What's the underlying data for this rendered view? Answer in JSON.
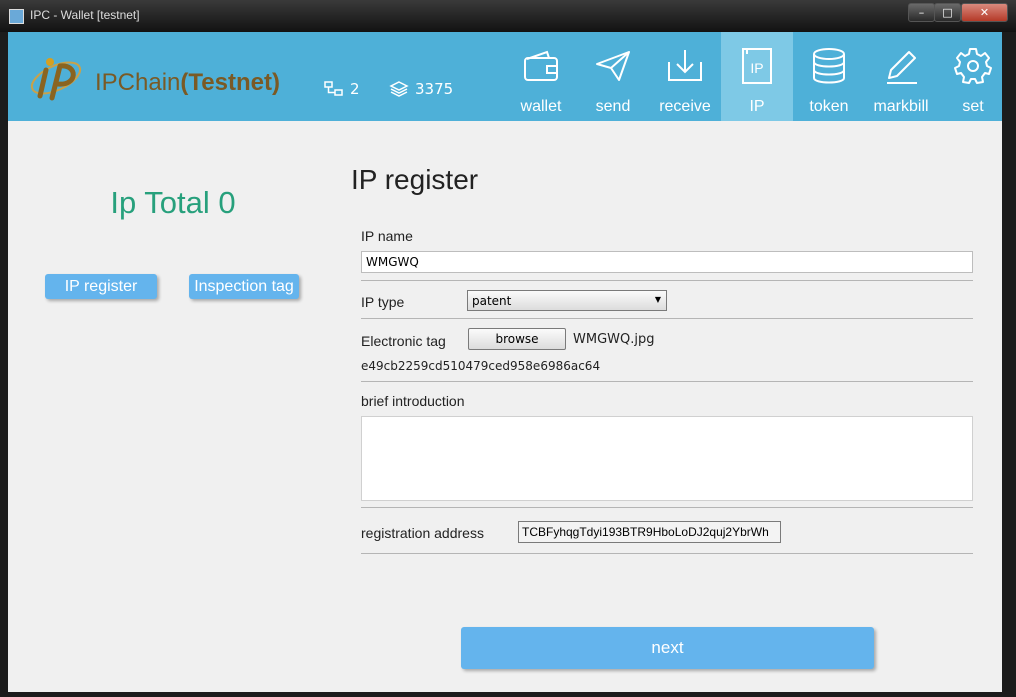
{
  "window": {
    "title": "IPC - Wallet [testnet]"
  },
  "header": {
    "logo_name": "IPChain",
    "logo_suffix": "(Testnet)",
    "peers": "2",
    "blocks": "3375",
    "nav": [
      {
        "label": "wallet",
        "icon": "wallet-icon"
      },
      {
        "label": "send",
        "icon": "send-icon"
      },
      {
        "label": "receive",
        "icon": "receive-icon"
      },
      {
        "label": "IP",
        "icon": "ip-icon",
        "active": true
      },
      {
        "label": "token",
        "icon": "token-icon"
      },
      {
        "label": "markbill",
        "icon": "pencil-icon"
      },
      {
        "label": "set",
        "icon": "gear-icon"
      }
    ]
  },
  "sidebar": {
    "total": "Ip Total 0",
    "register_btn": "IP register",
    "inspect_btn": "Inspection tag"
  },
  "form": {
    "title": "IP register",
    "ip_name_label": "IP name",
    "ip_name_value": "WMGWQ",
    "ip_type_label": "IP type",
    "ip_type_value": "patent",
    "tag_label": "Electronic tag",
    "browse_btn": "browse",
    "tag_file": "WMGWQ.jpg",
    "tag_hash": "e49cb2259cd510479ced958e6986ac64",
    "intro_label": "brief introduction",
    "intro_value": "",
    "address_label": "registration address",
    "address_value": "TCBFyhqgTdyi193BTR9HboLoDJ2quj2YbrWh",
    "next_btn": "next"
  },
  "colors": {
    "header_bg": "#4eb0d8",
    "active_tab": "#7ec9e6",
    "button_bg": "#64b4ed",
    "total_green": "#27a07c",
    "logo_brown": "#7a5a25"
  }
}
